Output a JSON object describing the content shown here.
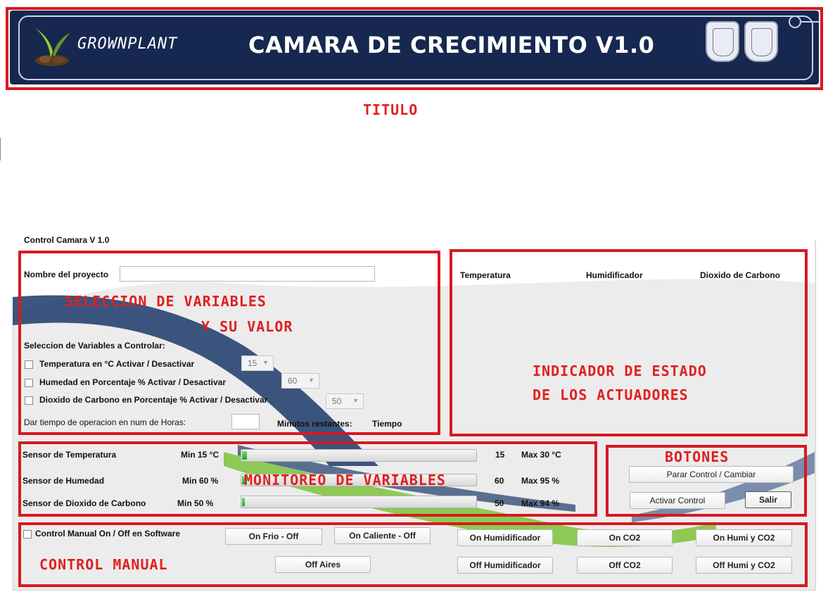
{
  "banner": {
    "brand": "GROWNPLANT",
    "title": "CAMARA DE CRECIMIENTO V1.0"
  },
  "annotations": {
    "titulo": "TITULO",
    "seleccion_line1": "SELECCION DE VARIABLES",
    "seleccion_line2": "Y SU VALOR",
    "indicador_line1": "INDICADOR DE ESTADO",
    "indicador_line2": "DE LOS ACTUADORES",
    "botones": "BOTONES",
    "monitoreo": "MONITOREO DE VARIABLES",
    "control_manual": "CONTROL MANUAL"
  },
  "group": {
    "legend": "Control Camara V 1.0"
  },
  "selection": {
    "project_label": "Nombre del proyecto",
    "project_value": "",
    "variables_label": "Seleccion de Variables a Controlar:",
    "rows": [
      {
        "label": "Temperatura en °C  Activar / Desactivar",
        "value": "15",
        "checked": false
      },
      {
        "label": "Humedad  en Porcentaje %  Activar / Desactivar",
        "value": "60",
        "checked": false
      },
      {
        "label": "Dioxido de Carbono en Porcentaje %  Activar / Desactivar",
        "value": "50",
        "checked": false
      }
    ],
    "time_label": "Dar tiempo de operacion en num de Horas:",
    "time_value": "",
    "remaining_label": "Minutos restantes:",
    "remaining_value": "Tiempo"
  },
  "actuators": {
    "headers": [
      "Temperatura",
      "Humidificador",
      "Dioxido de Carbono"
    ]
  },
  "monitor": {
    "sensors": [
      {
        "label": "Sensor de Temperatura",
        "min": "Min 15 °C",
        "value": "15",
        "max": "Max 30 °C",
        "level": 0.02
      },
      {
        "label": "Sensor de Humedad",
        "min": "Min 60 %",
        "value": "60",
        "max": "Max 95 %",
        "level": 0.02
      },
      {
        "label": "Sensor de Dioxido de Carbono",
        "min": "Min 50 %",
        "value": "50",
        "max": "Max 94 %",
        "level": 0.01
      }
    ]
  },
  "buttons": {
    "stop": "Parar Control / Cambiar",
    "activate": "Activar Control",
    "exit": "Salir"
  },
  "manual": {
    "checkbox_label": "Control Manual On / Off en Software",
    "checked": false,
    "on_frio": "On Frio - Off",
    "on_caliente": "On Caliente - Off",
    "off_aires": "Off Aires",
    "on_humidificador": "On Humidificador",
    "off_humidificador": "Off Humidificador",
    "on_co2": "On CO2",
    "off_co2": "Off CO2",
    "on_humi_co2": "On Humi y CO2",
    "off_humi_co2": "Off Humi y CO2"
  },
  "colors": {
    "banner_bg": "#16284f",
    "annotation_red": "#e0201f",
    "progress_green": "#1fa81f"
  }
}
